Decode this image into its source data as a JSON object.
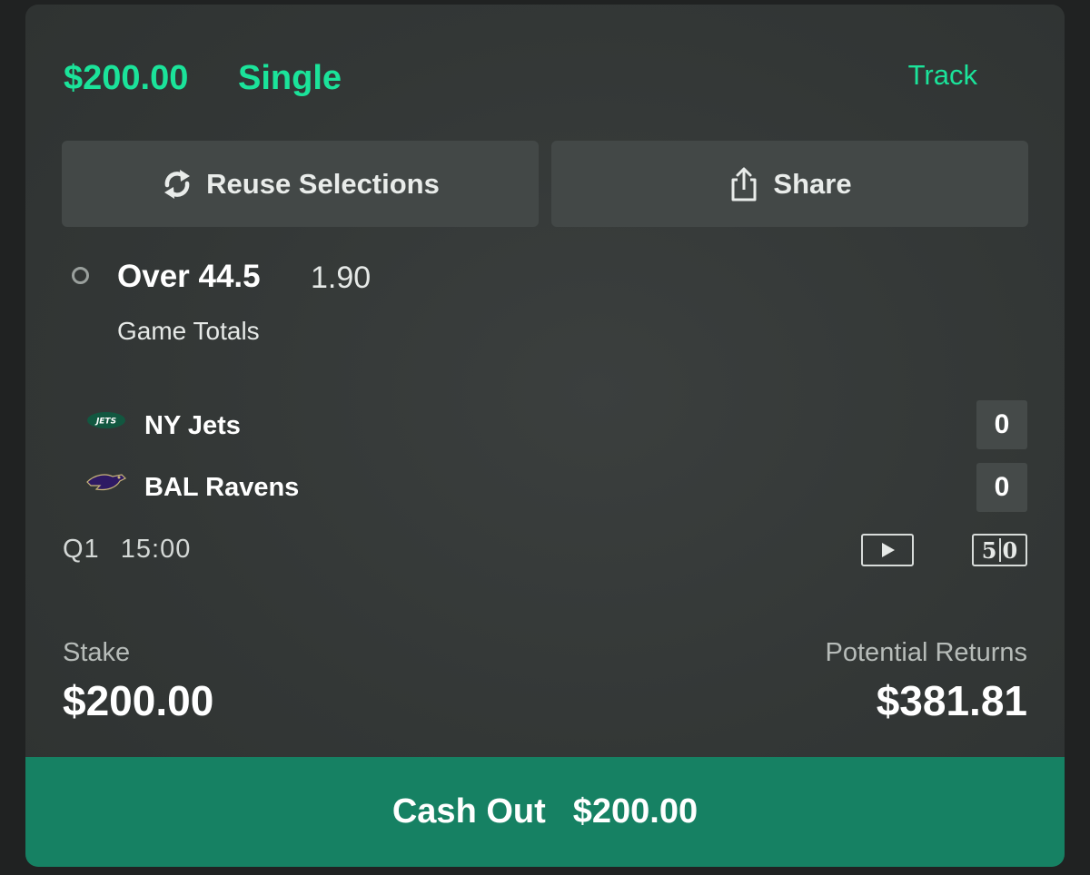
{
  "bet": {
    "amount": "$200.00",
    "type": "Single",
    "track_label": "Track"
  },
  "actions": {
    "reuse_label": "Reuse Selections",
    "share_label": "Share"
  },
  "selection": {
    "name": "Over 44.5",
    "odds": "1.90",
    "market": "Game Totals"
  },
  "teams": [
    {
      "name": "NY Jets",
      "score": "0",
      "logo": "jets-logo-icon"
    },
    {
      "name": "BAL Ravens",
      "score": "0",
      "logo": "ravens-logo-icon"
    }
  ],
  "game": {
    "period": "Q1",
    "clock": "15:00",
    "stats_icon_text": "50"
  },
  "summary": {
    "stake_label": "Stake",
    "stake_value": "$200.00",
    "returns_label": "Potential Returns",
    "returns_value": "$381.81"
  },
  "cashout": {
    "label": "Cash Out",
    "amount": "$200.00"
  },
  "colors": {
    "accent": "#1be39a",
    "cashout_bg": "#168163",
    "card_bg": "#333736",
    "button_bg": "#434847"
  }
}
